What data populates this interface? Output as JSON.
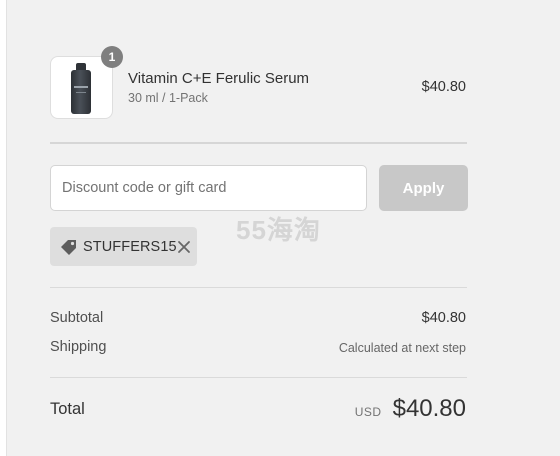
{
  "line_item": {
    "quantity": "1",
    "name": "Vitamin C+E Ferulic Serum",
    "variant": "30 ml / 1-Pack",
    "price": "$40.80",
    "image_icon": "serum-bottle"
  },
  "discount": {
    "placeholder": "Discount code or gift card",
    "value": "",
    "apply_label": "Apply",
    "applied_code": "STUFFERS15",
    "tag_icon": "tag-icon",
    "remove_icon": "close-icon"
  },
  "watermark": "55海淘",
  "totals": {
    "subtotal_label": "Subtotal",
    "subtotal_value": "$40.80",
    "shipping_label": "Shipping",
    "shipping_value": "Calculated at next step",
    "total_label": "Total",
    "currency": "USD",
    "total_value": "$40.80"
  },
  "colors": {
    "panel_bg": "#f1f1f1",
    "apply_disabled": "#c8c8c8",
    "chip_bg": "#dedede",
    "badge_bg": "#7f7f7f"
  }
}
